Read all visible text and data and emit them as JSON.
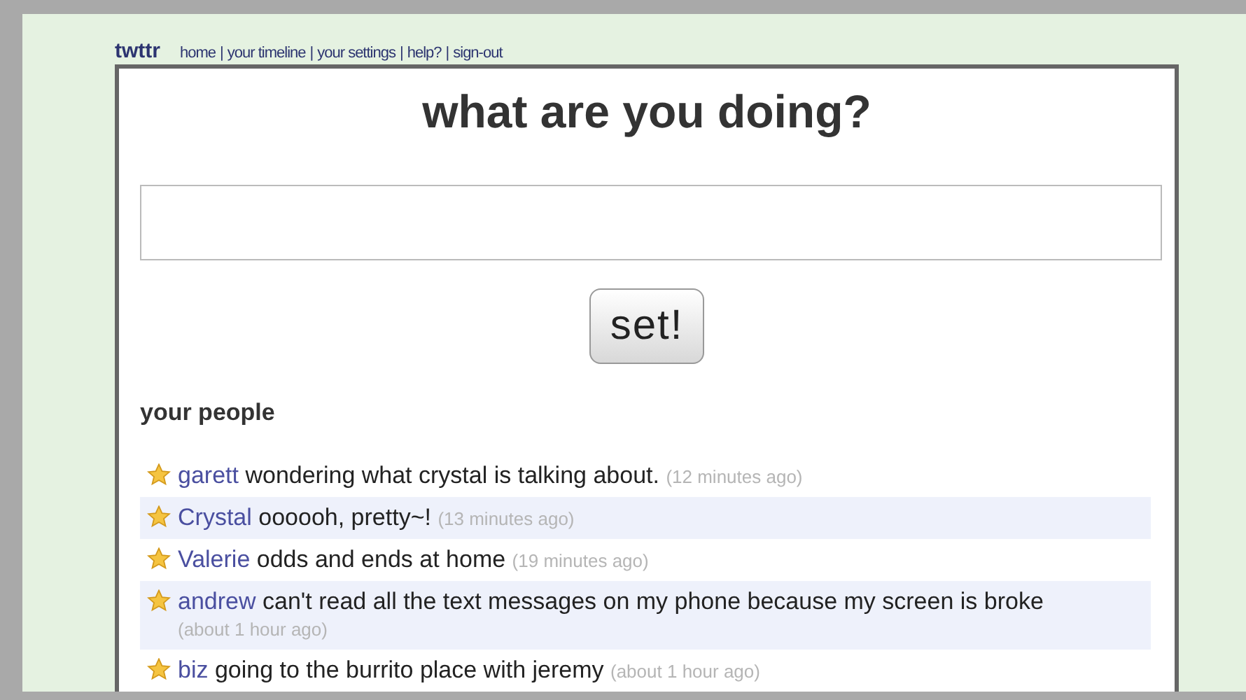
{
  "logo": "twttr",
  "nav": {
    "separator": "|",
    "links": [
      "home",
      "your timeline",
      "your settings",
      "help?",
      "sign-out"
    ]
  },
  "heading": "what are you doing?",
  "set_button": "set!",
  "people": {
    "title": "your people",
    "updates": [
      {
        "name": "garett",
        "text": "wondering what crystal is talking about.",
        "time": "(12 minutes ago)",
        "highlighted": false
      },
      {
        "name": "Crystal",
        "text": "oooooh, pretty~!",
        "time": "(13 minutes ago)",
        "highlighted": true
      },
      {
        "name": "Valerie",
        "text": "odds and ends at home",
        "time": "(19 minutes ago)",
        "highlighted": false
      },
      {
        "name": "andrew",
        "text": "can't read all the text messages on my phone because my screen is broke",
        "time": "(about 1 hour ago)",
        "highlighted": true
      },
      {
        "name": "biz",
        "text": "going to the burrito place with jeremy",
        "time": "(about 1 hour ago)",
        "highlighted": false
      }
    ]
  }
}
